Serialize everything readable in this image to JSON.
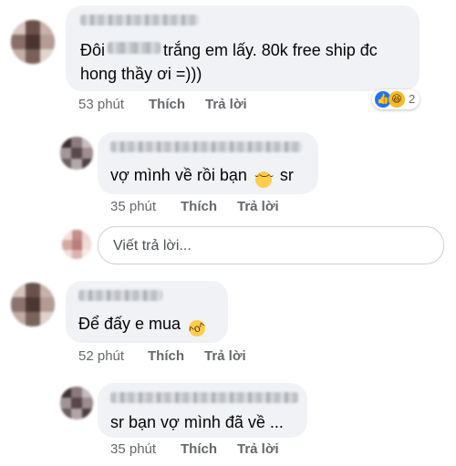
{
  "comments": [
    {
      "text_before": "Đôi",
      "text_after": "trắng em lấy.  80k free ship đc",
      "text_line2": "hong thầy ơi =)))",
      "time": "53 phút",
      "like": "Thích",
      "reply": "Trả lời",
      "reaction_count": "2",
      "replies": [
        {
          "text": "vợ mình về rồi bạn",
          "text_after_emoji": "sr",
          "emoji": "pensive-face-icon",
          "time": "35 phút",
          "like": "Thích",
          "reply": "Trả lời"
        }
      ]
    },
    {
      "text": "Để đấy e mua",
      "emoji": "rolling-laughing-icon",
      "time": "52 phút",
      "like": "Thích",
      "reply": "Trả lời",
      "replies": [
        {
          "text": "sr bạn vợ mình đã về ...",
          "time": "35 phút",
          "like": "Thích",
          "reply": "Trả lời"
        }
      ]
    }
  ],
  "reply_input": {
    "placeholder": "Viết trả lời..."
  },
  "colors": {
    "bubble": "#f0f2f5",
    "like_blue": "#1877f2",
    "haha_yellow": "#f7b928",
    "meta": "#65676b"
  }
}
